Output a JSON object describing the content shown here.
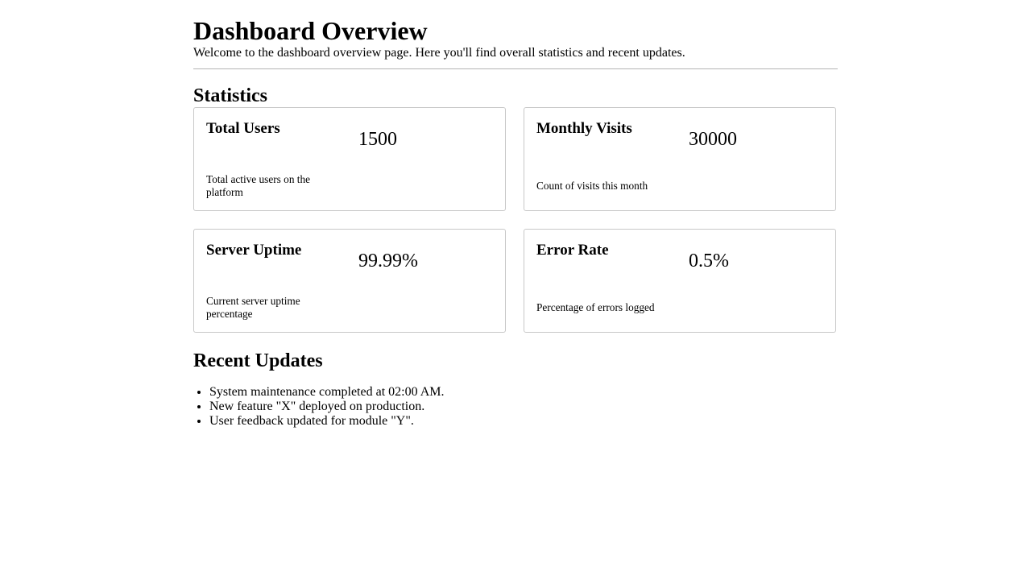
{
  "page": {
    "title": "Dashboard Overview",
    "subtitle": "Welcome to the dashboard overview page. Here you'll find overall statistics and recent updates."
  },
  "statistics": {
    "heading": "Statistics",
    "cards": [
      {
        "label": "Total Users",
        "value": "1500",
        "description": "Total active users on the platform"
      },
      {
        "label": "Monthly Visits",
        "value": "30000",
        "description": "Count of visits this month"
      },
      {
        "label": "Server Uptime",
        "value": "99.99%",
        "description": "Current server uptime percentage"
      },
      {
        "label": "Error Rate",
        "value": "0.5%",
        "description": "Percentage of errors logged"
      }
    ]
  },
  "updates": {
    "heading": "Recent Updates",
    "items": [
      "System maintenance completed at 02:00 AM.",
      "New feature \"X\" deployed on production.",
      "User feedback updated for module \"Y\"."
    ]
  }
}
